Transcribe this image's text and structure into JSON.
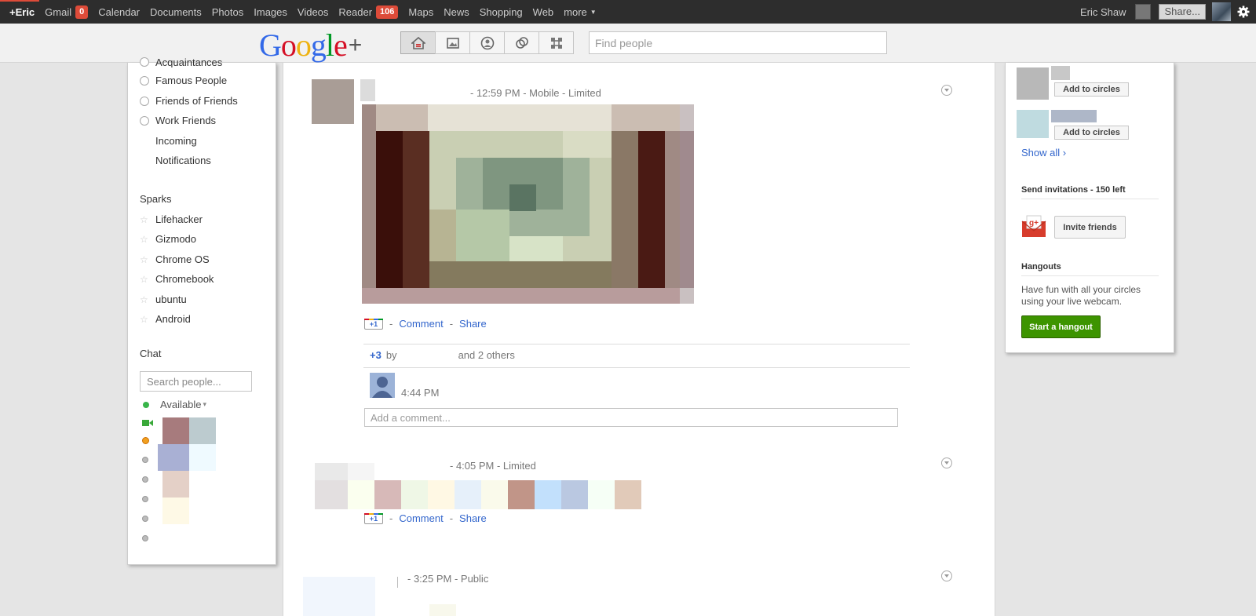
{
  "topbar": {
    "me": "+Eric",
    "items": [
      {
        "label": "Gmail",
        "count": "0"
      },
      {
        "label": "Calendar"
      },
      {
        "label": "Documents"
      },
      {
        "label": "Photos"
      },
      {
        "label": "Images"
      },
      {
        "label": "Videos"
      },
      {
        "label": "Reader",
        "count": "106"
      },
      {
        "label": "Maps"
      },
      {
        "label": "News"
      },
      {
        "label": "Shopping"
      },
      {
        "label": "Web"
      }
    ],
    "more": "more",
    "username": "Eric Shaw",
    "share": "Share...",
    "icons": {
      "notifications": "notification-box",
      "avatar": "profile-photo",
      "settings": "gear-icon"
    }
  },
  "header": {
    "logo_letters": [
      "G",
      "o",
      "o",
      "g",
      "l",
      "e"
    ],
    "logo_plus": "+",
    "nav_icons": [
      "home-icon",
      "photos-icon",
      "profile-icon",
      "circles-icon",
      "games-icon"
    ],
    "find_people_placeholder": "Find people"
  },
  "left": {
    "circles": [
      "Acquaintances",
      "Famous People",
      "Friends of Friends",
      "Work Friends"
    ],
    "plain": [
      "Incoming",
      "Notifications"
    ],
    "sparks_title": "Sparks",
    "sparks": [
      "Lifehacker",
      "Gizmodo",
      "Chrome OS",
      "Chromebook",
      "ubuntu",
      "Android"
    ],
    "chat_title": "Chat",
    "chat_search_placeholder": "Search people...",
    "available": "Available",
    "available_arrow": "▾"
  },
  "stream": {
    "posts": [
      {
        "meta": "-  12:59 PM  -  Mobile  -  Limited"
      },
      {
        "meta": "-  4:05 PM  -  Limited"
      },
      {
        "meta": "-  3:25 PM  -  Public"
      }
    ],
    "plus1_label": "+1",
    "comment": "Comment",
    "share": "Share",
    "dash": "-",
    "plus_count": "+3",
    "by": "by",
    "others": "and 2 others",
    "comment_time": "4:44 PM",
    "add_comment_placeholder": "Add a comment..."
  },
  "right": {
    "add_to_circles": "Add to circles",
    "show_all": "Show all ›",
    "invitations_title": "Send invitations - 150 left",
    "invite_friends": "Invite friends",
    "hangouts_title": "Hangouts",
    "hangouts_text": "Have fun with all your circles using your live webcam.",
    "start_hangout": "Start a hangout"
  },
  "colors": {
    "topbar_bg": "#2d2d2d",
    "count_badge": "#dd4b39",
    "link": "#3366cc",
    "hangout_green": "#3d9400",
    "available_green": "#39b54a"
  }
}
